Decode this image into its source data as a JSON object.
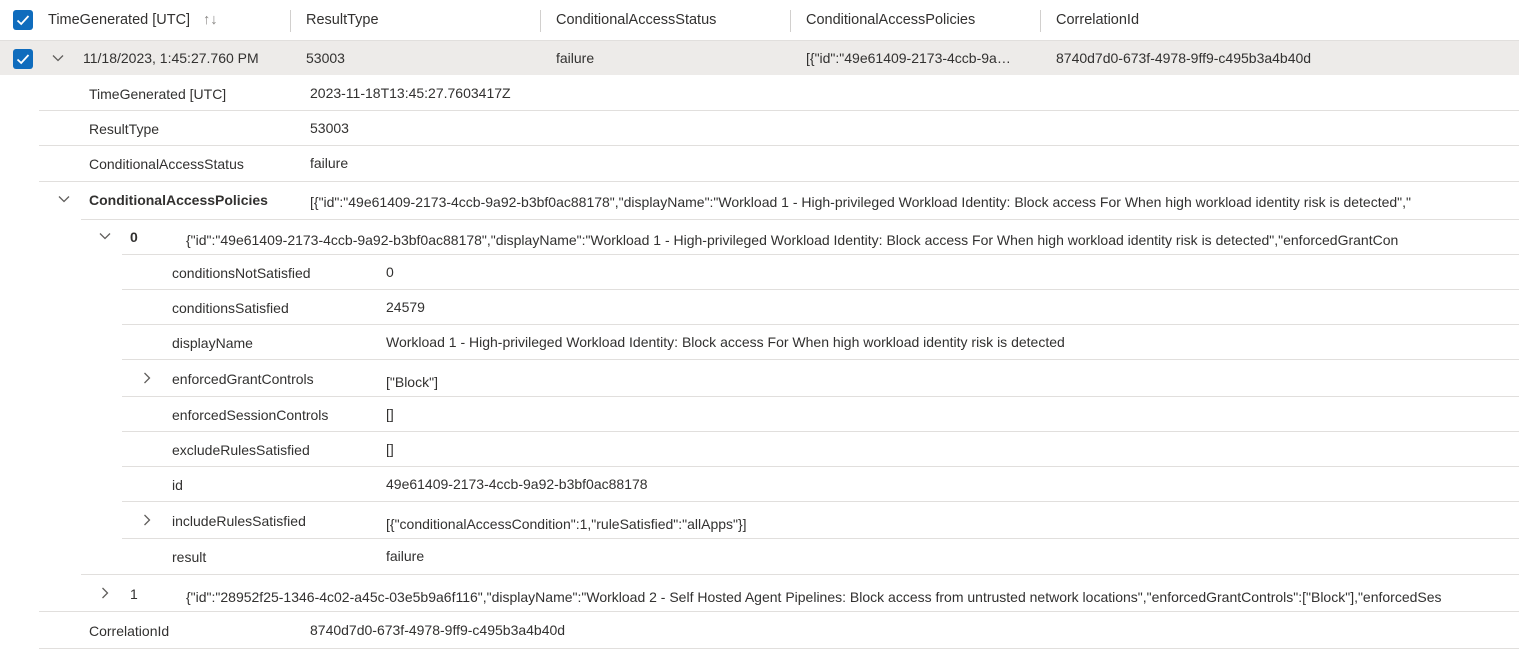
{
  "header": {
    "col_time": "TimeGenerated [UTC]",
    "sort_icon": "↑↓",
    "col_result": "ResultType",
    "col_status": "ConditionalAccessStatus",
    "col_policies": "ConditionalAccessPolicies",
    "col_correlation": "CorrelationId"
  },
  "row": {
    "time": "11/18/2023, 1:45:27.760 PM",
    "result": "53003",
    "status": "failure",
    "policies": "[{\"id\":\"49e61409-2173-4ccb-9a…",
    "correlation": "8740d7d0-673f-4978-9ff9-c495b3a4b40d"
  },
  "details": [
    {
      "key": "TimeGenerated [UTC]",
      "value": "2023-11-18T13:45:27.7603417Z"
    },
    {
      "key": "ResultType",
      "value": "53003"
    },
    {
      "key": "ConditionalAccessStatus",
      "value": "failure"
    }
  ],
  "policies": {
    "key": "ConditionalAccessPolicies",
    "value": "[{\"id\":\"49e61409-2173-4ccb-9a92-b3bf0ac88178\",\"displayName\":\"Workload 1 - High-privileged Workload Identity: Block access For When high workload identity risk is detected\",\"",
    "item0": {
      "index": "0",
      "value": "{\"id\":\"49e61409-2173-4ccb-9a92-b3bf0ac88178\",\"displayName\":\"Workload 1 - High-privileged Workload Identity: Block access For When high workload identity risk is detected\",\"enforcedGrantCon",
      "fields": [
        {
          "key": "conditionsNotSatisfied",
          "value": "0"
        },
        {
          "key": "conditionsSatisfied",
          "value": "24579"
        },
        {
          "key": "displayName",
          "value": "Workload 1 - High-privileged Workload Identity: Block access For When high workload identity risk is detected"
        },
        {
          "key": "enforcedGrantControls",
          "value": "[\"Block\"]"
        },
        {
          "key": "enforcedSessionControls",
          "value": "[]"
        },
        {
          "key": "excludeRulesSatisfied",
          "value": "[]"
        },
        {
          "key": "id",
          "value": "49e61409-2173-4ccb-9a92-b3bf0ac88178"
        },
        {
          "key": "includeRulesSatisfied",
          "value": "[{\"conditionalAccessCondition\":1,\"ruleSatisfied\":\"allApps\"}]"
        },
        {
          "key": "result",
          "value": "failure"
        }
      ]
    },
    "item1": {
      "index": "1",
      "value": "{\"id\":\"28952f25-1346-4c02-a45c-03e5b9a6f116\",\"displayName\":\"Workload 2 - Self Hosted Agent Pipelines: Block access from untrusted network locations\",\"enforcedGrantControls\":[\"Block\"],\"enforcedSes"
    }
  },
  "correlation": {
    "key": "CorrelationId",
    "value": "8740d7d0-673f-4978-9ff9-c495b3a4b40d"
  },
  "colors": {
    "accent": "#0f6cbd",
    "selected_row": "#edebe9",
    "divider": "#e1dfdd"
  }
}
